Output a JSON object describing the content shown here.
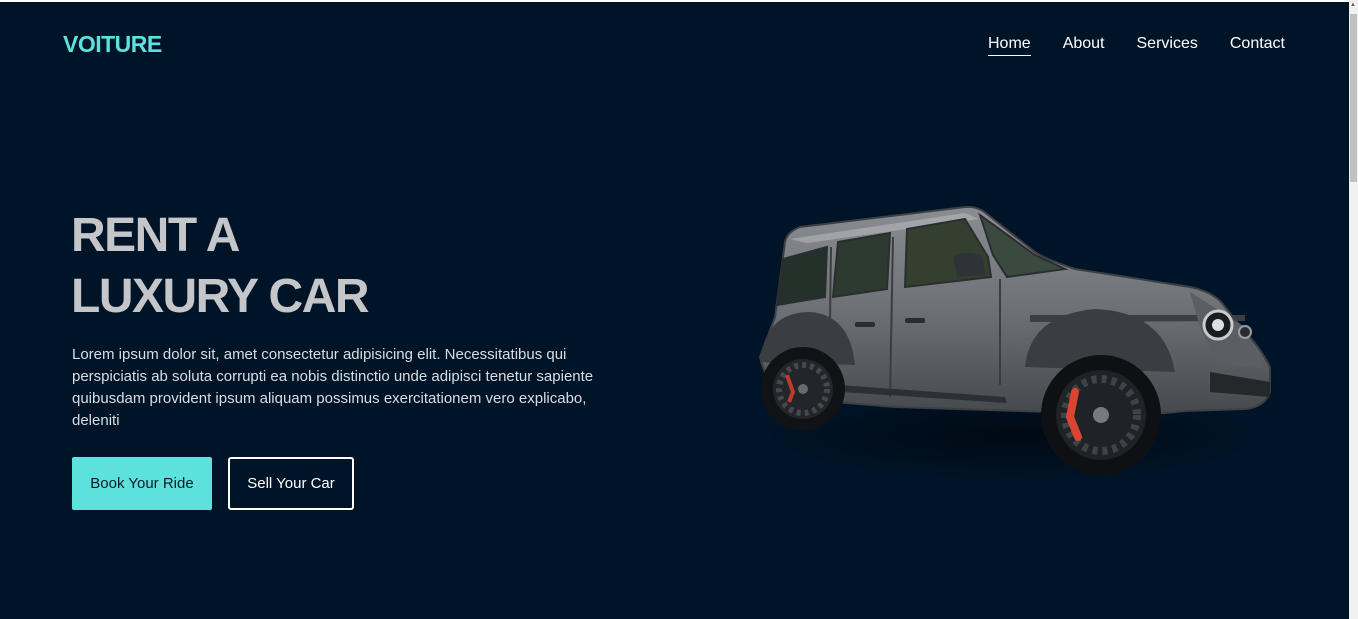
{
  "brand": {
    "logo": "VOITURE",
    "accent_color": "#5ce1dc",
    "background_color": "#001428"
  },
  "nav": {
    "items": [
      {
        "label": "Home",
        "active": true
      },
      {
        "label": "About",
        "active": false
      },
      {
        "label": "Services",
        "active": false
      },
      {
        "label": "Contact",
        "active": false
      }
    ]
  },
  "hero": {
    "title_line1": "RENT A",
    "title_line2": "LUXURY CAR",
    "description": "Lorem ipsum dolor sit, amet consectetur adipisicing elit. Necessitatibus qui perspiciatis ab soluta corrupti ea nobis distinctio unde adipisci tenetur sapiente quibusdam provident ipsum aliquam possimus exercitationem vero explicabo, deleniti",
    "primary_button": "Book Your Ride",
    "secondary_button": "Sell Your Car",
    "image": "luxury-suv-image"
  },
  "scrollbar": {
    "up_arrow": "▲"
  }
}
